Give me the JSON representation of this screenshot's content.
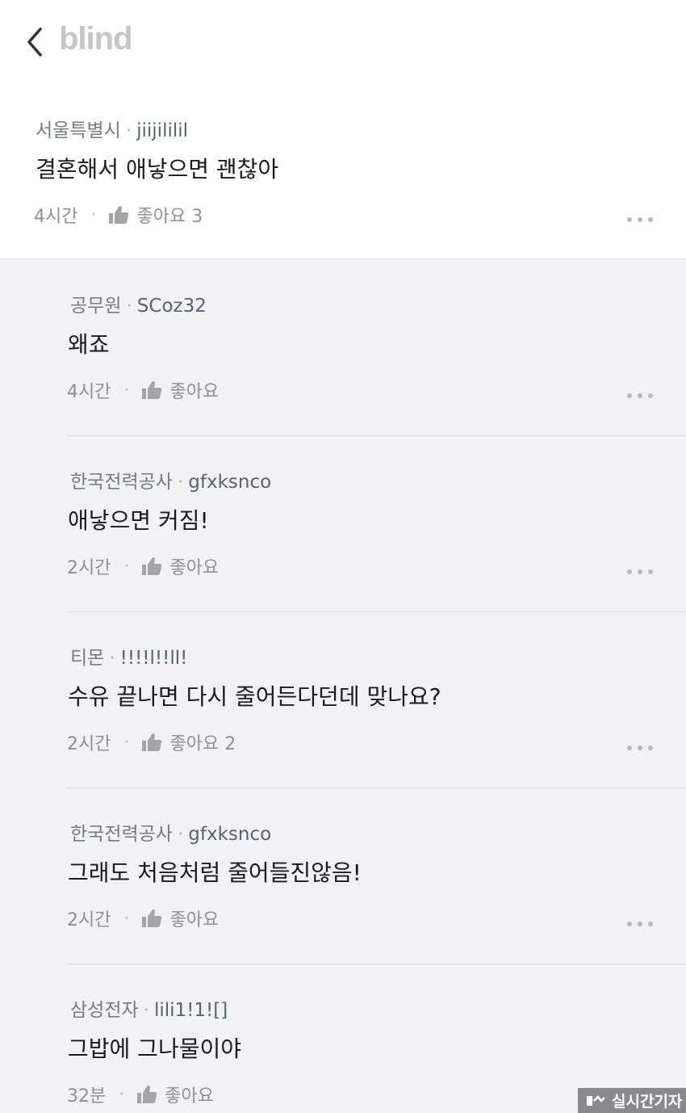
{
  "header": {
    "logo": "blind"
  },
  "comments": [
    {
      "company": "서울특별시",
      "nickname": "jiijililil",
      "text": "결혼해서 애낳으면 괜찮아",
      "time": "4시간",
      "like_label": "좋아요 3"
    },
    {
      "company": "공무원",
      "nickname": "SCoz32",
      "text": "왜죠",
      "time": "4시간",
      "like_label": "좋아요"
    },
    {
      "company": "한국전력공사",
      "nickname": "gfxksnco",
      "text": "애낳으면 커짐!",
      "time": "2시간",
      "like_label": "좋아요"
    },
    {
      "company": "티몬",
      "nickname": "!!!!l!!ll!",
      "text": "수유 끝나면 다시 줄어든다던데 맞나요?",
      "time": "2시간",
      "like_label": "좋아요 2"
    },
    {
      "company": "한국전력공사",
      "nickname": "gfxksnco",
      "text": "그래도 처음처럼 줄어들진않음!",
      "time": "2시간",
      "like_label": "좋아요"
    },
    {
      "company": "삼성전자",
      "nickname": "lili1!1![]",
      "text": "그밥에 그나물이야",
      "time": "32분",
      "like_label": "좋아요"
    }
  ],
  "watermark": {
    "text": "실시간기자"
  },
  "colors": {
    "background": "#f2f2f4",
    "main_comment_bg": "#ffffff",
    "logo": "#c6c6c8"
  },
  "icons": {
    "back": "chevron-left-icon",
    "like": "thumbs-up-icon",
    "more": "more-horizontal-icon"
  }
}
